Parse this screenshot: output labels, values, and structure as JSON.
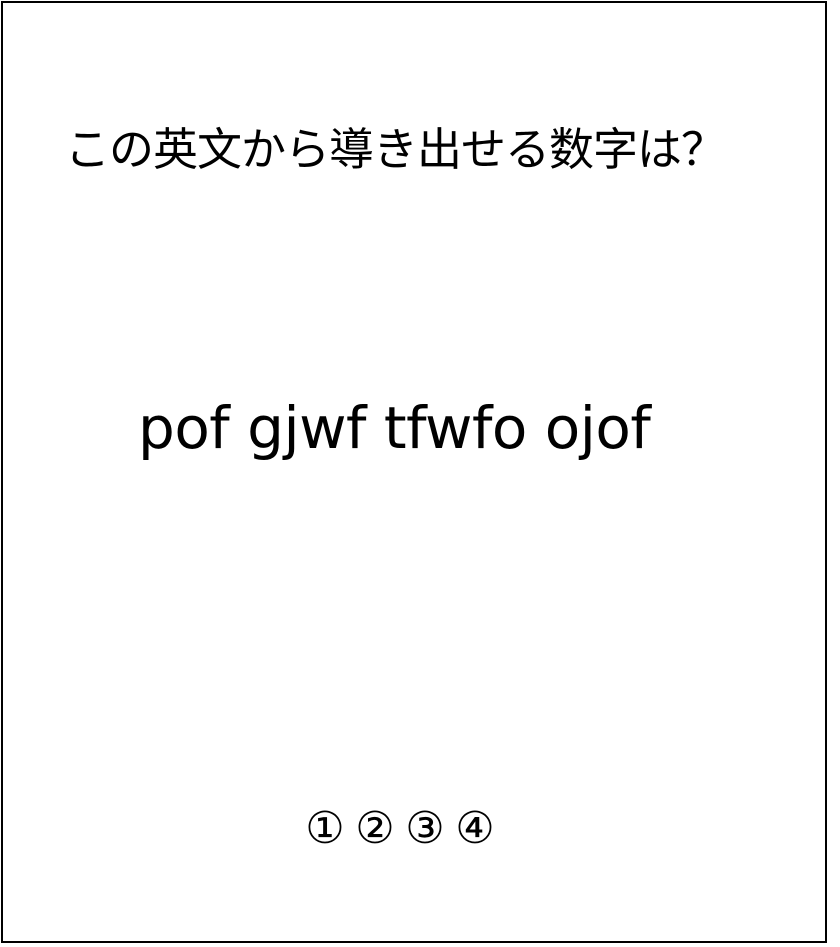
{
  "question": "この英文から導き出せる数字は？",
  "cipher_text": "pof gjwf tfwfo ojof",
  "choices": [
    "①",
    "②",
    "③",
    "④"
  ]
}
